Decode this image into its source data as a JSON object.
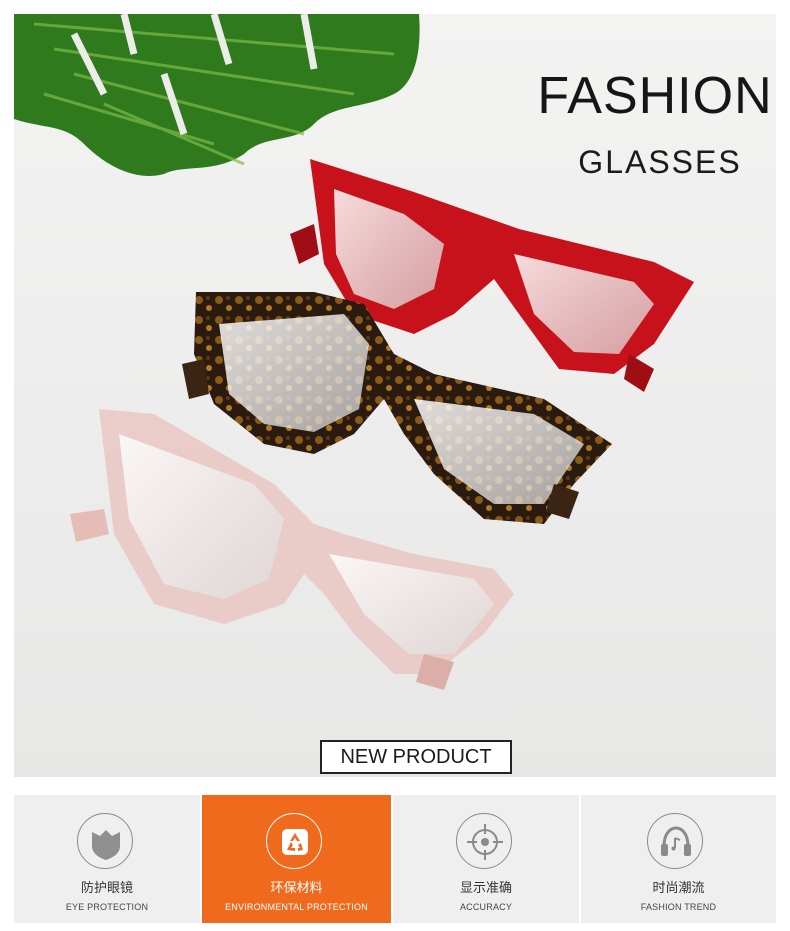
{
  "hero": {
    "title": "FASHION",
    "subtitle": "GLASSES",
    "new_product_label": "NEW PRODUCT"
  },
  "colors": {
    "accent": "#f06a1d",
    "feature_bg": "#efefef",
    "red_frame": "#c8121b",
    "tortoise_frame": "#2a1a10",
    "pink_frame": "#e9c9c4"
  },
  "features": [
    {
      "icon": "shield-icon",
      "label_cn": "防护眼镜",
      "label_en": "EYE PROTECTION",
      "active": false
    },
    {
      "icon": "recycle-icon",
      "label_cn": "环保材料",
      "label_en": "ENVIRONMENTAL PROTECTION",
      "active": true
    },
    {
      "icon": "crosshair-icon",
      "label_cn": "显示准确",
      "label_en": "ACCURACY",
      "active": false
    },
    {
      "icon": "headphones-icon",
      "label_cn": "时尚潮流",
      "label_en": "FASHION TREND",
      "active": false
    }
  ]
}
